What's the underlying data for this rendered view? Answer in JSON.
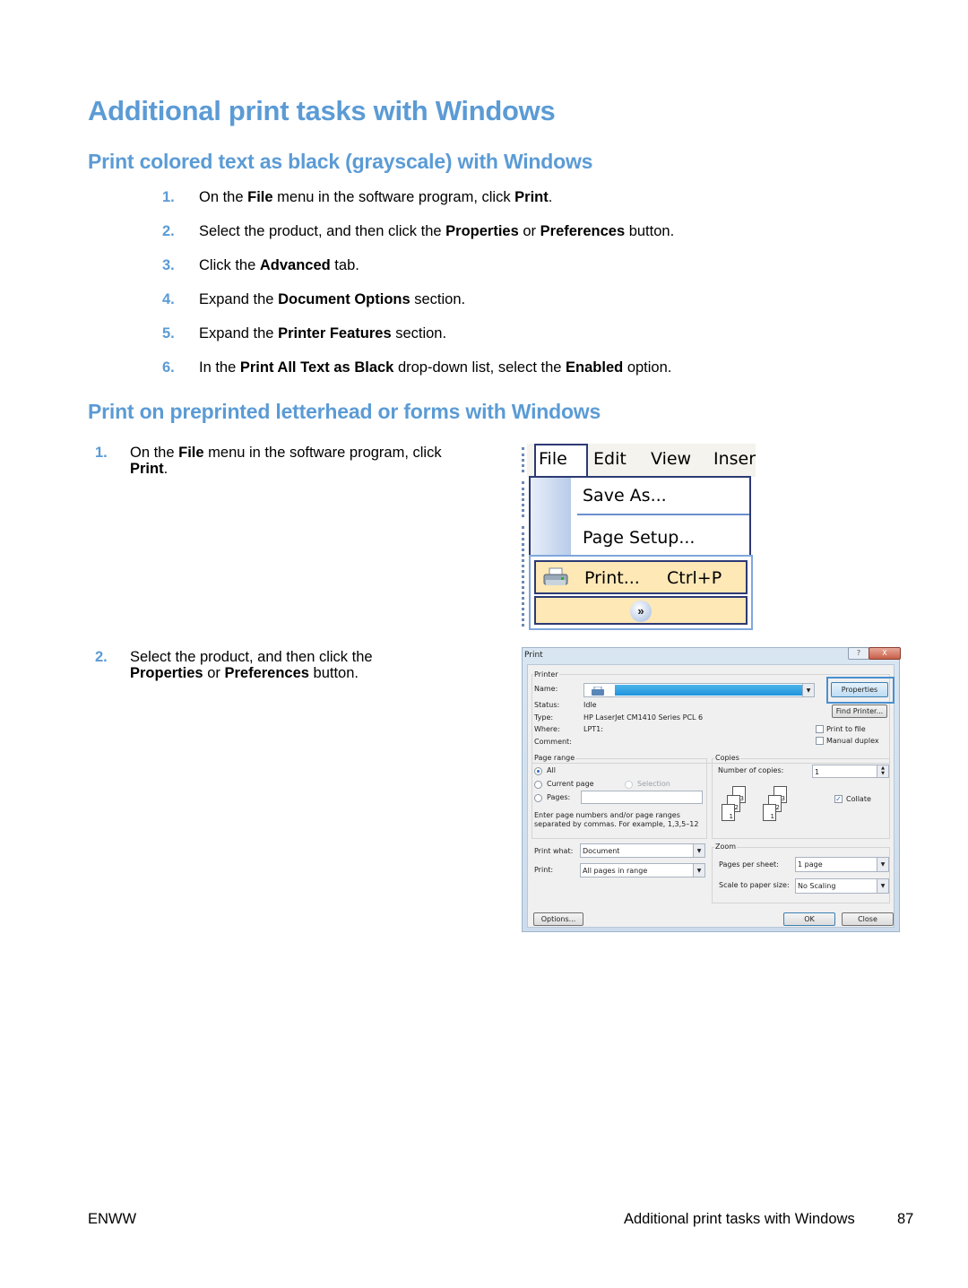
{
  "page": {
    "title": "Additional print tasks with Windows",
    "accent_color": "#5b9bd5"
  },
  "section1": {
    "heading": "Print colored text as black (grayscale) with Windows",
    "steps": [
      {
        "num": "1.",
        "parts": [
          "On the ",
          "File",
          " menu in the software program, click ",
          "Print",
          "."
        ]
      },
      {
        "num": "2.",
        "parts": [
          "Select the product, and then click the ",
          "Properties",
          " or ",
          "Preferences",
          " button."
        ]
      },
      {
        "num": "3.",
        "parts": [
          "Click the ",
          "Advanced",
          " tab."
        ]
      },
      {
        "num": "4.",
        "parts": [
          "Expand the ",
          "Document Options",
          " section."
        ]
      },
      {
        "num": "5.",
        "parts": [
          "Expand the ",
          "Printer Features",
          " section."
        ]
      },
      {
        "num": "6.",
        "parts": [
          "In the ",
          "Print All Text as Black",
          " drop-down list, select the ",
          "Enabled",
          " option."
        ]
      }
    ]
  },
  "section2": {
    "heading": "Print on preprinted letterhead or forms with Windows",
    "steps": [
      {
        "num": "1.",
        "line1": [
          "On the ",
          "File",
          " menu in the software program, click"
        ],
        "line2": [
          "Print",
          "."
        ]
      },
      {
        "num": "2.",
        "line1": [
          "Select the product, and then click the"
        ],
        "line2": [
          "Properties",
          " or ",
          "Preferences",
          " button."
        ]
      }
    ]
  },
  "file_menu_screenshot": {
    "menubar": [
      "File",
      "Edit",
      "View",
      "Inser"
    ],
    "items": [
      {
        "label": "Save As..."
      },
      {
        "label": "Page Setup..."
      },
      {
        "label": "Print...",
        "shortcut": "Ctrl+P",
        "icon": "printer-icon",
        "highlighted": true
      }
    ],
    "expand_icon": "double-chevron-down-icon"
  },
  "print_dialog_screenshot": {
    "title": "Print",
    "title_buttons": [
      "?",
      "X"
    ],
    "printer_group": {
      "label": "Printer",
      "name_label": "Name:",
      "name_value": "",
      "status_label": "Status:",
      "status_value": "Idle",
      "type_label": "Type:",
      "type_value": "HP LaserJet CM1410 Series PCL 6",
      "where_label": "Where:",
      "where_value": "LPT1:",
      "comment_label": "Comment:",
      "properties_button": "Properties",
      "find_printer_button": "Find Printer...",
      "print_to_file": {
        "label": "Print to file",
        "checked": false
      },
      "manual_duplex": {
        "label": "Manual duplex",
        "checked": false
      }
    },
    "page_range_group": {
      "label": "Page range",
      "all": {
        "label": "All",
        "selected": true
      },
      "current_page": {
        "label": "Current page",
        "selected": false
      },
      "selection": {
        "label": "Selection",
        "selected": false,
        "disabled": true
      },
      "pages": {
        "label": "Pages:",
        "selected": false,
        "value": ""
      },
      "hint_line1": "Enter page numbers and/or page ranges",
      "hint_line2": "separated by commas.  For example, 1,3,5–12"
    },
    "copies_group": {
      "label": "Copies",
      "number_label": "Number of copies:",
      "number_value": "1",
      "collate": {
        "label": "Collate",
        "checked": true
      },
      "page_stack_labels": [
        "3",
        "2",
        "1"
      ]
    },
    "print_what_label": "Print what:",
    "print_what_value": "Document",
    "print_label": "Print:",
    "print_value": "All pages in range",
    "zoom_group": {
      "label": "Zoom",
      "pages_per_sheet_label": "Pages per sheet:",
      "pages_per_sheet_value": "1 page",
      "scale_label": "Scale to paper size:",
      "scale_value": "No Scaling"
    },
    "options_button": "Options...",
    "ok_button": "OK",
    "close_button": "Close"
  },
  "footer": {
    "left": "ENWW",
    "section": "Additional print tasks with Windows",
    "page_number": "87"
  }
}
